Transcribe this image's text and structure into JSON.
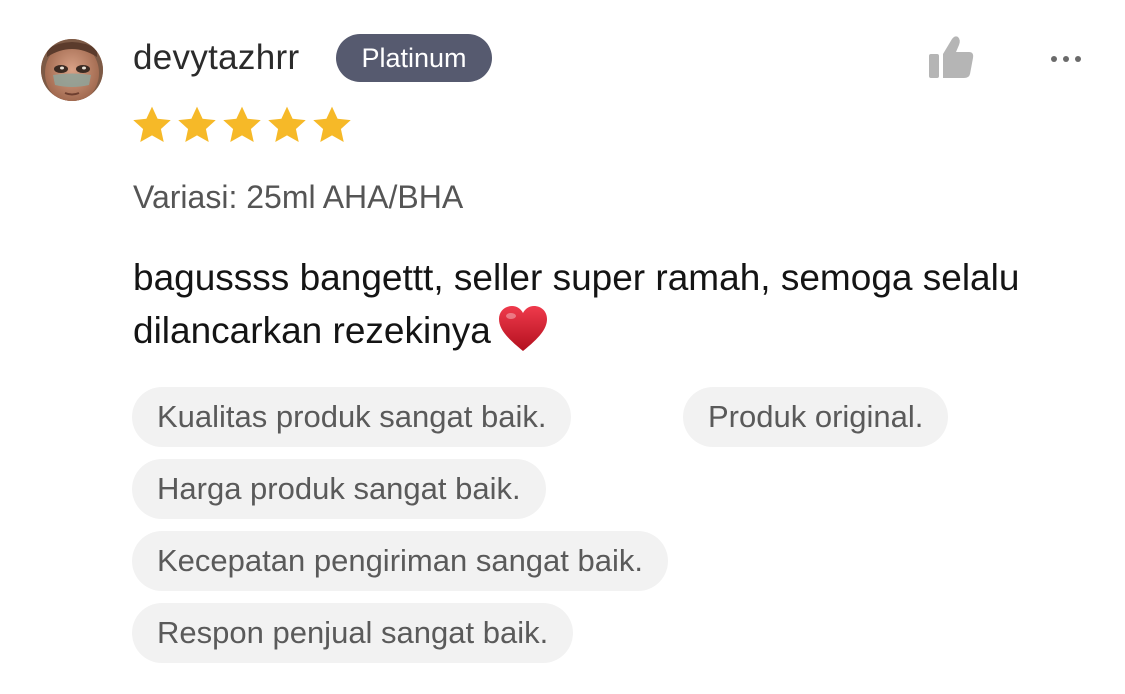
{
  "review": {
    "username": "devytazhrr",
    "badge": "Platinum",
    "rating": 5,
    "rating_max": 5,
    "variation": "Variasi: 25ml AHA/BHA",
    "comment": "bagussss bangettt, seller super ramah, semoga selalu dilancarkan rezekinya",
    "comment_emoji": "heart-emoji",
    "tags": [
      "Kualitas produk sangat baik.",
      "Produk original.",
      "Harga produk sangat baik.",
      "Kecepatan pengiriman sangat baik.",
      "Respon penjual sangat baik."
    ]
  },
  "icons": {
    "like": "thumbs-up-icon",
    "more": "more-options-icon",
    "star": "star-icon"
  },
  "colors": {
    "badge_bg": "#565a6f",
    "star": "#f6b928",
    "tag_bg": "#f2f2f2",
    "icon": "#b5b5b5",
    "heart": "#d3192f"
  }
}
